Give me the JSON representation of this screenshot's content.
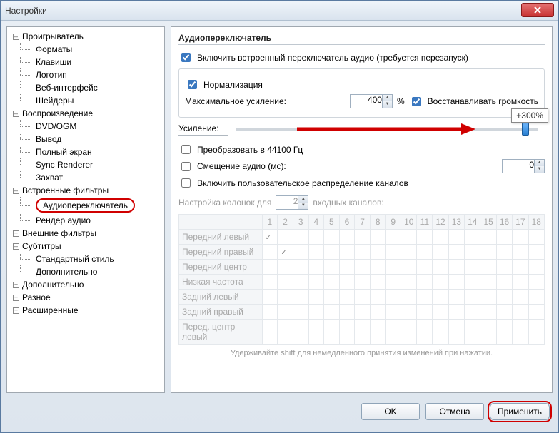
{
  "window": {
    "title": "Настройки"
  },
  "tree": [
    {
      "label": "Проигрыватель",
      "level": 1,
      "expanded": true
    },
    {
      "label": "Форматы",
      "level": 2
    },
    {
      "label": "Клавиши",
      "level": 2
    },
    {
      "label": "Логотип",
      "level": 2
    },
    {
      "label": "Веб-интерфейс",
      "level": 2
    },
    {
      "label": "Шейдеры",
      "level": 2
    },
    {
      "label": "Воспроизведение",
      "level": 1,
      "expanded": true
    },
    {
      "label": "DVD/OGM",
      "level": 2
    },
    {
      "label": "Вывод",
      "level": 2
    },
    {
      "label": "Полный экран",
      "level": 2
    },
    {
      "label": "Sync Renderer",
      "level": 2
    },
    {
      "label": "Захват",
      "level": 2
    },
    {
      "label": "Встроенные фильтры",
      "level": 1,
      "expanded": true
    },
    {
      "label": "Аудиопереключатель",
      "level": 2,
      "selected": true
    },
    {
      "label": "Рендер аудио",
      "level": 2
    },
    {
      "label": "Внешние фильтры",
      "level": 1,
      "expanded": false
    },
    {
      "label": "Субтитры",
      "level": 1,
      "expanded": true
    },
    {
      "label": "Стандартный стиль",
      "level": 2
    },
    {
      "label": "Дополнительно",
      "level": 2
    },
    {
      "label": "Дополнительно",
      "level": 1,
      "expanded": false
    },
    {
      "label": "Разное",
      "level": 1,
      "expanded": false
    },
    {
      "label": "Расширенные",
      "level": 1,
      "expanded": false
    }
  ],
  "panel": {
    "title": "Аудиопереключатель",
    "enable": {
      "label": "Включить встроенный переключатель аудио (требуется перезапуск)",
      "checked": true
    },
    "normalize": {
      "label": "Нормализация",
      "checked": true
    },
    "maxgain_label": "Максимальное усиление:",
    "maxgain_value": "400",
    "maxgain_suffix": "%",
    "restore": {
      "label": "Восстанавливать громкость",
      "checked": true
    },
    "gain_label": "Усиление:",
    "gain_tooltip": "+300%",
    "downsample": {
      "label": "Преобразовать в 44100 Гц",
      "checked": false
    },
    "audioshift": {
      "label": "Смещение аудио (мс):",
      "checked": false,
      "value": "0"
    },
    "custommap": {
      "label": "Включить пользовательское распределение каналов",
      "checked": false
    },
    "speakerconf_prefix": "Настройка колонок для",
    "speakerconf_value": "2",
    "speakerconf_suffix": "входных каналов:",
    "channels_cols": [
      "1",
      "2",
      "3",
      "4",
      "5",
      "6",
      "7",
      "8",
      "9",
      "10",
      "11",
      "12",
      "13",
      "14",
      "15",
      "16",
      "17",
      "18"
    ],
    "channels_rows": [
      "Передний левый",
      "Передний правый",
      "Передний центр",
      "Низкая частота",
      "Задний левый",
      "Задний правый",
      "Перед. центр левый"
    ],
    "hint": "Удерживайте shift для немедленного принятия изменений при нажатии."
  },
  "buttons": {
    "ok": "OK",
    "cancel": "Отмена",
    "apply": "Применить"
  }
}
